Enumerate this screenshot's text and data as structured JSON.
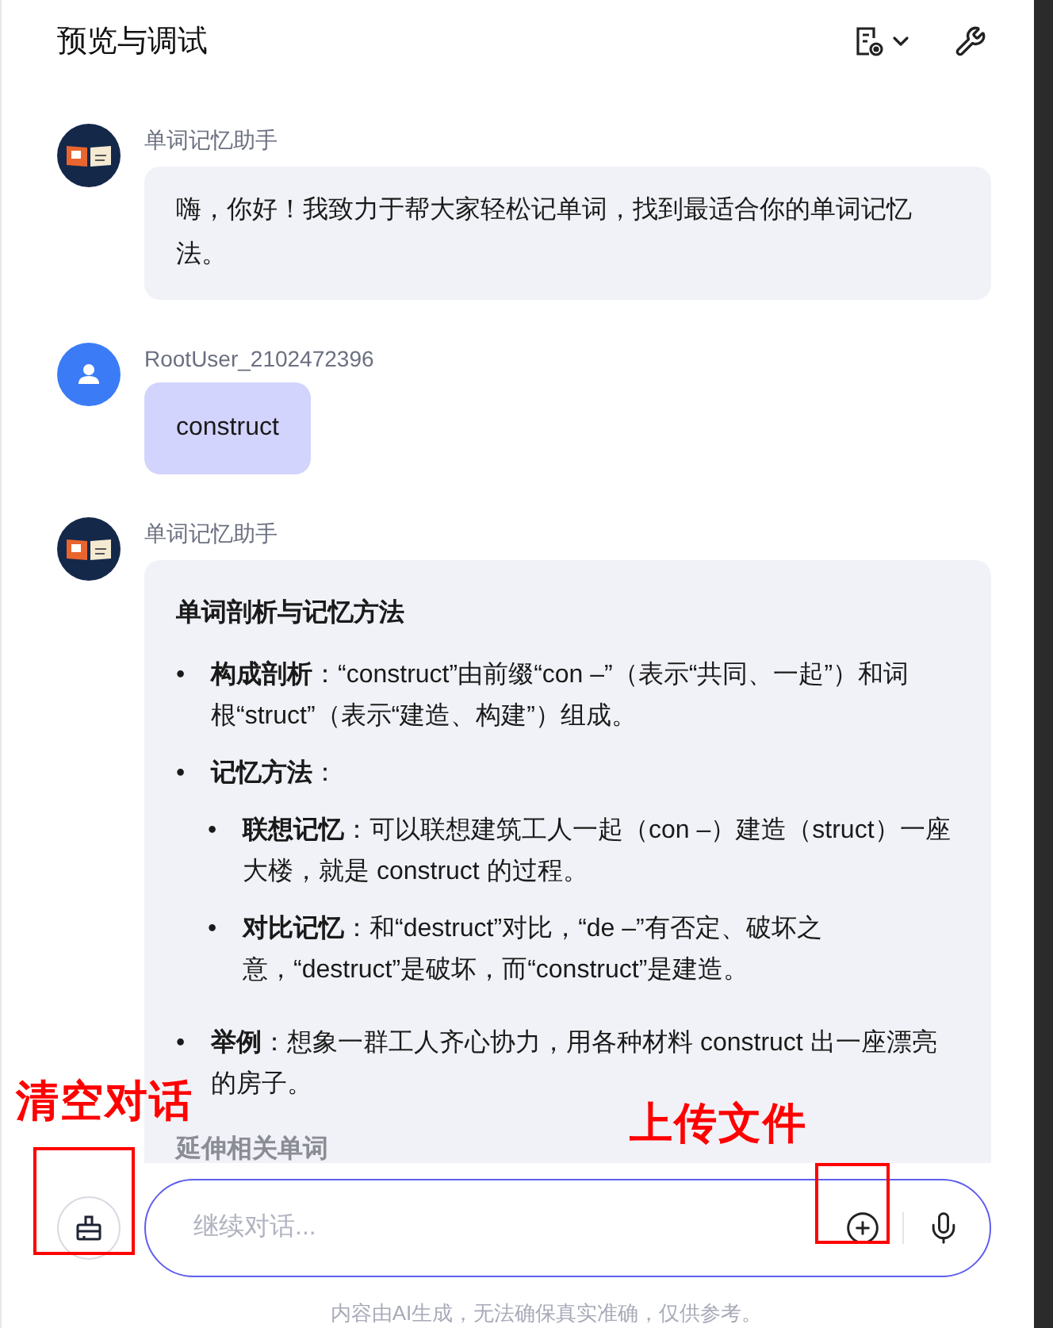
{
  "header": {
    "title": "预览与调试"
  },
  "messages": [
    {
      "kind": "bot",
      "sender": "单词记忆助手",
      "text": "嗨，你好！我致力于帮大家轻松记单词，找到最适合你的单词记忆法。"
    },
    {
      "kind": "user",
      "sender": "RootUser_2102472396",
      "text": "construct"
    },
    {
      "kind": "bot",
      "sender": "单词记忆助手",
      "heading": "单词剖析与记忆方法",
      "items": [
        {
          "marker": "•",
          "text": "**构成剖析**：“construct”由前缀“con –”（表示“共同、一起”）和词根“struct”（表示“建造、构建”）组成。"
        },
        {
          "marker": "•",
          "text": "**记忆方法**：",
          "children": [
            {
              "marker": "•",
              "text": "**联想记忆**：可以联想建筑工人一起（con –）建造（struct）一座大楼，就是 construct 的过程。"
            },
            {
              "marker": "•",
              "text": "**对比记忆**：和“destruct”对比，“de –”有否定、破坏之意，“destruct”是破坏，而“construct”是建造。"
            }
          ]
        },
        {
          "marker": "•",
          "text": "**举例**：想象一群工人齐心协力，用各种材料 construct 出一座漂亮的房子。"
        }
      ],
      "subheading": "延伸相关单词"
    }
  ],
  "composer": {
    "placeholder": "继续对话..."
  },
  "disclaimer": "内容由AI生成，无法确保真实准确，仅供参考。",
  "annotations": [
    {
      "kind": "clear",
      "text": "清空对话"
    },
    {
      "kind": "upload",
      "text": "上传文件"
    }
  ]
}
